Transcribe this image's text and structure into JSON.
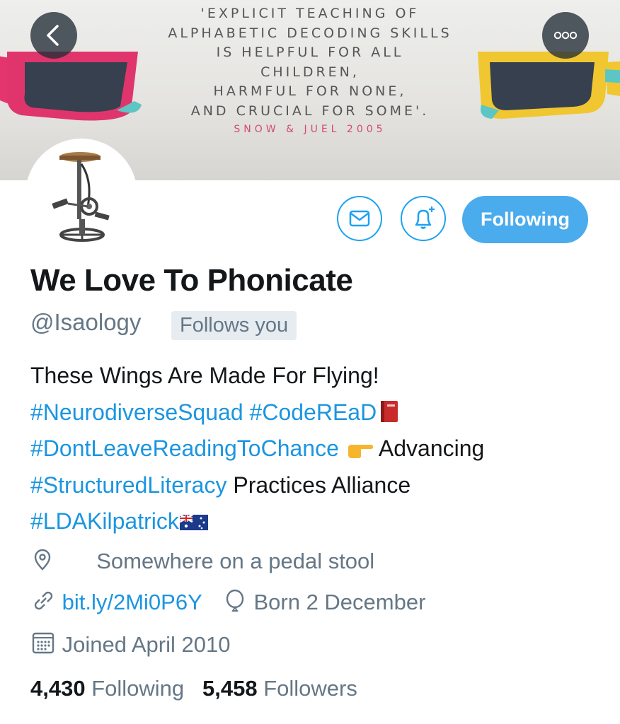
{
  "banner": {
    "quote_lines": [
      "'EXPLICIT TEACHING OF",
      "ALPHABETIC DECODING SKILLS",
      "IS HELPFUL FOR ALL",
      "CHILDREN,",
      "HARMFUL FOR NONE,",
      "AND CRUCIAL FOR SOME'."
    ],
    "citation": "SNOW & JUEL 2005"
  },
  "icons": {
    "back": "chevron-left-icon",
    "more": "more-horizontal-icon",
    "message": "envelope-icon",
    "notify": "bell-plus-icon",
    "location": "location-pin-icon",
    "link": "link-icon",
    "birthday": "balloon-icon",
    "joined": "calendar-icon"
  },
  "profile": {
    "follow_button": "Following",
    "display_name": "We Love To Phonicate",
    "handle": "@Isaology",
    "follows_you": "Follows you"
  },
  "bio": {
    "line1": "These Wings Are Made For Flying!",
    "tag1": "#NeurodiverseSquad",
    "tag2": "#CodeREaD",
    "tag3": "#DontLeaveReadingToChance",
    "text_advancing": "Advancing",
    "tag4": "#StructuredLiteracy",
    "text_alliance": "Practices Alliance",
    "tag5": "#LDAKilpatrick"
  },
  "meta": {
    "location": "Somewhere on a pedal stool",
    "url": "bit.ly/2Mi0P6Y",
    "birthday": "Born 2 December",
    "joined": "Joined April 2010"
  },
  "stats": {
    "following_count": "4,430",
    "following_label": "Following",
    "followers_count": "5,458",
    "followers_label": "Followers"
  },
  "colors": {
    "accent": "#1da1f2",
    "link": "#1b95e0",
    "secondary_text": "#657786",
    "citation": "#d44a73"
  }
}
